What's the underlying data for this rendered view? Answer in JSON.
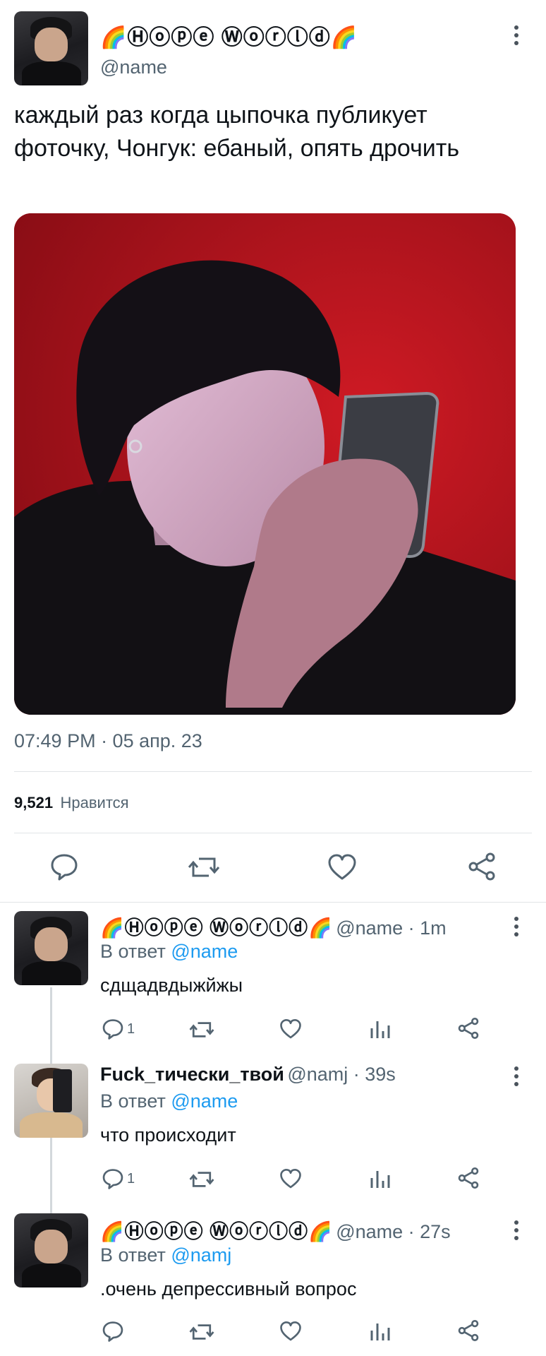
{
  "main_tweet": {
    "display_name": "🌈Ⓗⓞⓟⓔ Ⓦⓞⓡⓛⓓ🌈",
    "handle": "@name",
    "text": "каждый раз когда цыпочка публикует фоточку,  Чонгук: ебаный,  опять дрочить",
    "timestamp": "07:49 PM · 05 апр. 23",
    "likes_count": "9,521",
    "likes_label": "Нравится",
    "icons": [
      "reply-icon",
      "retweet-icon",
      "like-icon",
      "share-icon"
    ]
  },
  "replies": [
    {
      "display_name": "🌈Ⓗⓞⓟⓔ Ⓦⓞⓡⓛⓓ🌈",
      "meta": "@name · 1m",
      "reply_to_prefix": "В ответ",
      "reply_to_handle": "@name",
      "text": "сдщадвдыжйжы",
      "reply_count": "1"
    },
    {
      "display_name": "Fuck_тически_твой",
      "meta": "@namj · 39s",
      "reply_to_prefix": "В ответ",
      "reply_to_handle": "@name",
      "text": "что происходит",
      "reply_count": "1"
    },
    {
      "display_name": "🌈Ⓗⓞⓟⓔ Ⓦⓞⓡⓛⓓ🌈",
      "meta": "@name · 27s",
      "reply_to_prefix": "В ответ",
      "reply_to_handle": "@namj",
      "text": ".очень депрессивный вопрос",
      "reply_count": ""
    }
  ],
  "colors": {
    "accent": "#1d9bf0",
    "muted": "#536471",
    "photo_background": "#b3141d"
  }
}
